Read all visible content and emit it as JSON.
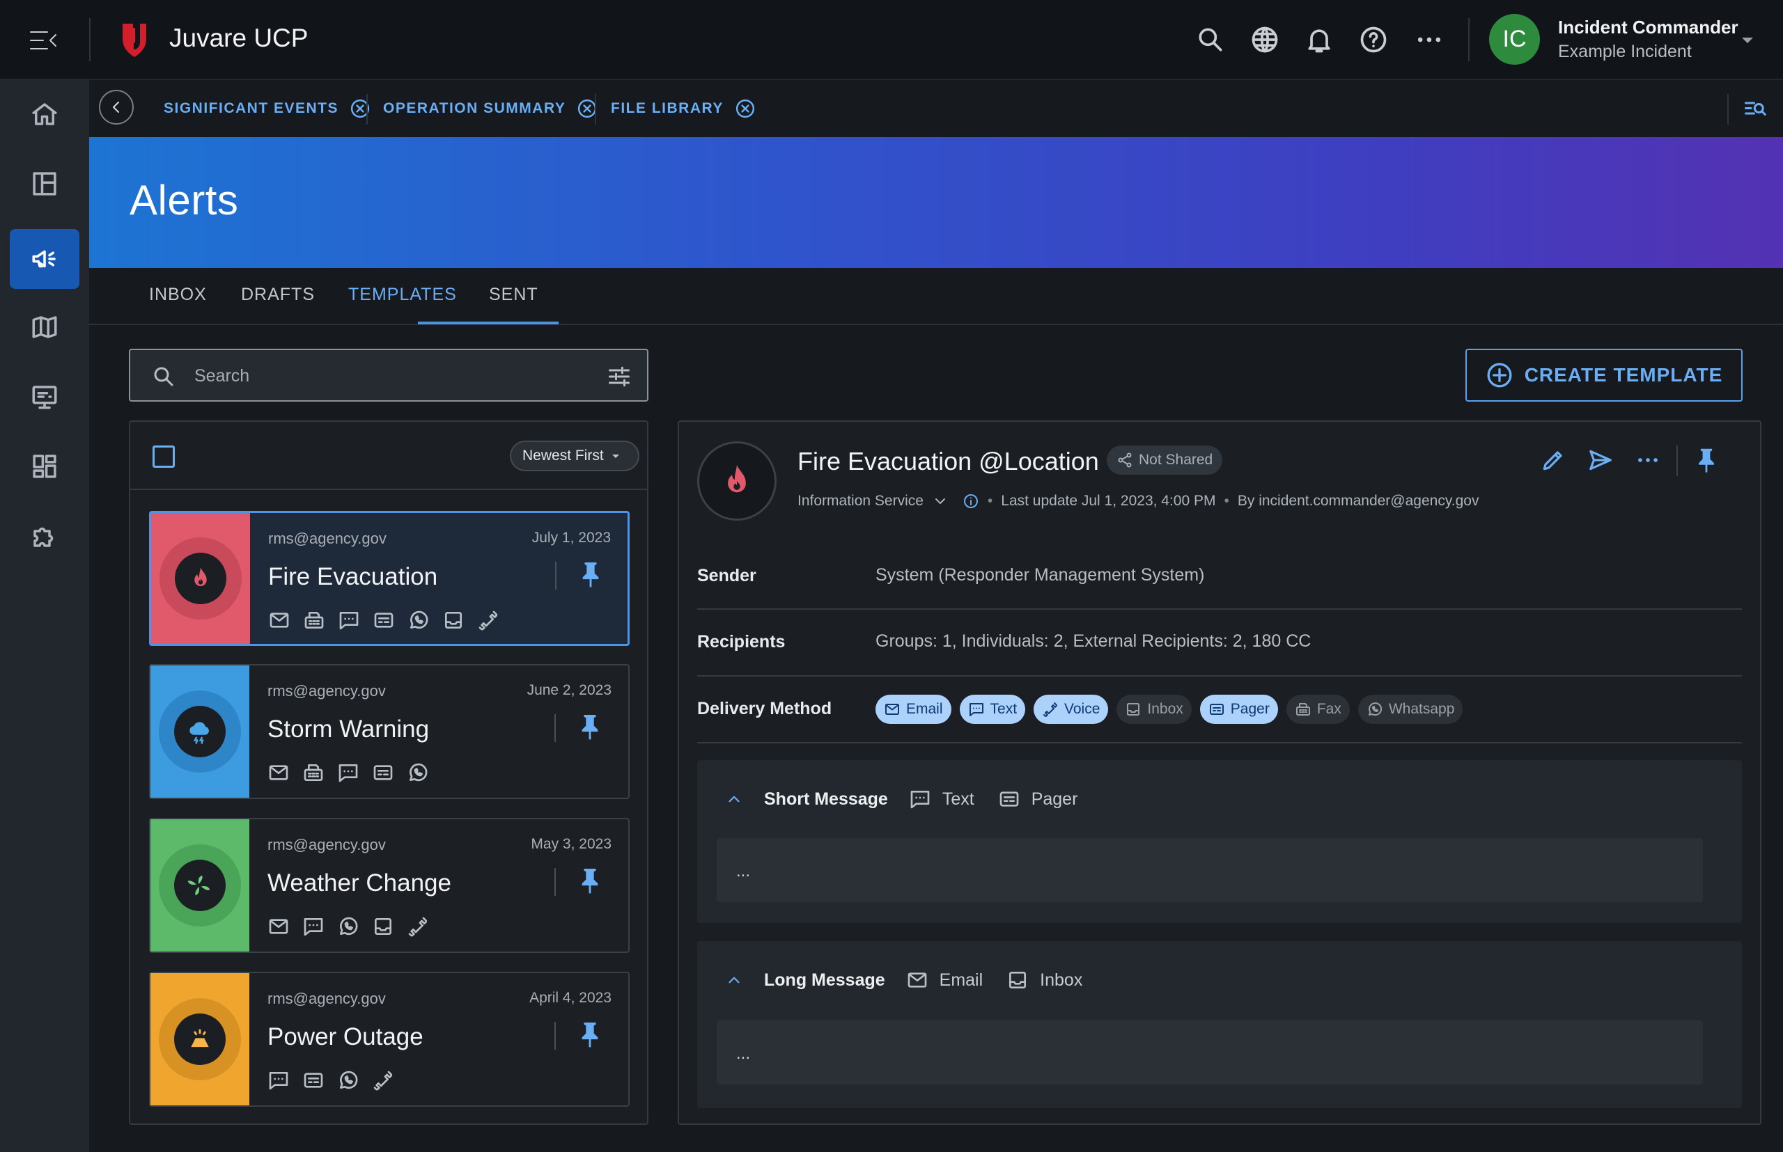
{
  "app": {
    "title": "Juvare UCP"
  },
  "user": {
    "initials": "IC",
    "name": "Incident Commander",
    "incident": "Example Incident"
  },
  "open_tabs": [
    {
      "label": "SIGNIFICANT EVENTS"
    },
    {
      "label": "OPERATION SUMMARY"
    },
    {
      "label": "FILE LIBRARY"
    }
  ],
  "page": {
    "title": "Alerts"
  },
  "section_tabs": [
    {
      "label": "INBOX"
    },
    {
      "label": "DRAFTS"
    },
    {
      "label": "TEMPLATES",
      "active": true
    },
    {
      "label": "SENT"
    }
  ],
  "search": {
    "placeholder": "Search",
    "value": ""
  },
  "create_button": {
    "label": "CREATE TEMPLATE"
  },
  "list": {
    "sort": "Newest First",
    "items": [
      {
        "sender": "rms@agency.gov",
        "date": "July 1, 2023",
        "title": "Fire Evacuation",
        "icon": "fire-icon",
        "color": "#e05a6b",
        "selected": true,
        "methods": [
          "email",
          "fax",
          "text",
          "pager",
          "whatsapp",
          "inbox",
          "voice"
        ]
      },
      {
        "sender": "rms@agency.gov",
        "date": "June 2, 2023",
        "title": "Storm Warning",
        "icon": "storm-icon",
        "color": "#3d9be0",
        "methods": [
          "email",
          "fax",
          "text",
          "pager",
          "whatsapp"
        ]
      },
      {
        "sender": "rms@agency.gov",
        "date": "May 3, 2023",
        "title": "Weather Change",
        "icon": "wind-icon",
        "color": "#5cba6a",
        "methods": [
          "email",
          "text",
          "whatsapp",
          "inbox",
          "voice"
        ]
      },
      {
        "sender": "rms@agency.gov",
        "date": "April 4, 2023",
        "title": "Power Outage",
        "icon": "power-icon",
        "color": "#f0a62e",
        "methods": [
          "text",
          "pager",
          "whatsapp",
          "voice"
        ]
      }
    ]
  },
  "detail": {
    "title": "Fire Evacuation @Location",
    "shared": "Not Shared",
    "service": "Information Service",
    "last_update": "Last update Jul 1, 2023, 4:00 PM",
    "by": "By incident.commander@agency.gov",
    "fields": {
      "sender_label": "Sender",
      "sender_value": "System (Responder Management System)",
      "recipients_label": "Recipients",
      "recipients_value": "Groups: 1, Individuals: 2, External Recipients: 2, 180 CC",
      "delivery_label": "Delivery Method"
    },
    "delivery_methods": [
      {
        "label": "Email",
        "on": true
      },
      {
        "label": "Text",
        "on": true
      },
      {
        "label": "Voice",
        "on": true
      },
      {
        "label": "Inbox",
        "on": false
      },
      {
        "label": "Pager",
        "on": true
      },
      {
        "label": "Fax",
        "on": false
      },
      {
        "label": "Whatsapp",
        "on": false
      }
    ],
    "short_message": {
      "title": "Short Message",
      "channel1": "Text",
      "channel2": "Pager",
      "body": "..."
    },
    "long_message": {
      "title": "Long Message",
      "channel1": "Email",
      "channel2": "Inbox",
      "body": "..."
    }
  },
  "colors": {
    "accent": "#6aaef5",
    "active_nav": "#1758b3",
    "avatar": "#2e8b3e",
    "brand_red": "#d11f2b"
  }
}
